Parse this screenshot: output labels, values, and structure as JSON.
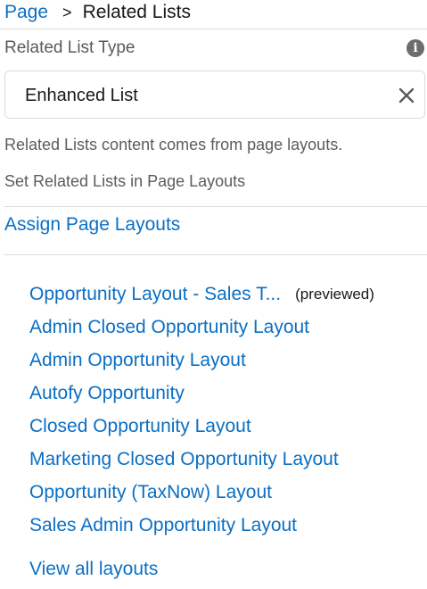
{
  "breadcrumb": {
    "parent": "Page",
    "separator": ">",
    "current": "Related Lists"
  },
  "related_list_type": {
    "label": "Related List Type",
    "info_icon": "info-icon",
    "selected_value": "Enhanced List",
    "clear_icon": "close-icon"
  },
  "help": {
    "content_source": "Related Lists content comes from page layouts.",
    "set_in_layouts": "Set Related Lists in Page Layouts"
  },
  "assign_link": "Assign Page Layouts",
  "layouts": [
    {
      "label": "Opportunity Layout - Sales T...",
      "badge": "(previewed)"
    },
    {
      "label": "Admin Closed Opportunity Layout"
    },
    {
      "label": "Admin Opportunity Layout"
    },
    {
      "label": "Autofy Opportunity"
    },
    {
      "label": "Closed Opportunity Layout"
    },
    {
      "label": "Marketing Closed Opportunity Layout"
    },
    {
      "label": "Opportunity (TaxNow) Layout"
    },
    {
      "label": "Sales Admin Opportunity Layout"
    }
  ],
  "view_all": "View all layouts",
  "colors": {
    "link": "#0b6fc4",
    "text": "#3e3e3c",
    "divider": "#dddbda",
    "icon": "#6b6d70"
  }
}
